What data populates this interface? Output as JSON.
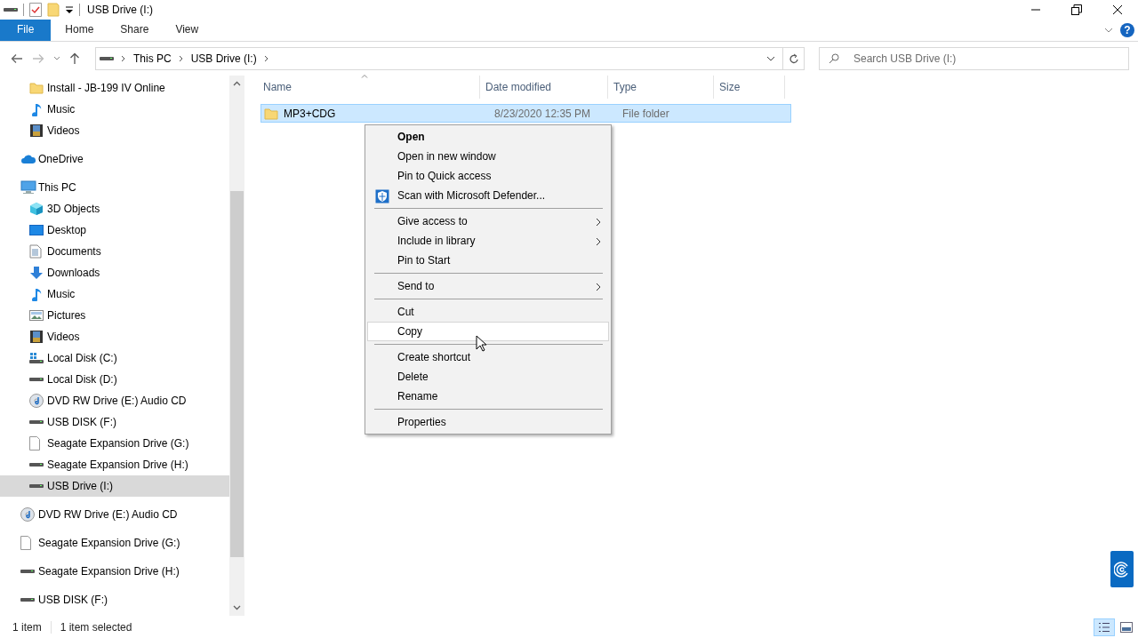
{
  "window": {
    "title": "USB Drive (I:)"
  },
  "ribbon": {
    "tabs": [
      {
        "label": "File",
        "kind": "file",
        "selected": false
      },
      {
        "label": "Home",
        "kind": "tab",
        "selected": false
      },
      {
        "label": "Share",
        "kind": "tab",
        "selected": false
      },
      {
        "label": "View",
        "kind": "tab",
        "selected": false
      }
    ],
    "help": "?"
  },
  "address": {
    "breadcrumbs": [
      "This PC",
      "USB Drive (I:)"
    ]
  },
  "search": {
    "placeholder": "Search USB Drive (I:)"
  },
  "sidebar": {
    "sections": [
      {
        "children": [
          {
            "label": "Install - JB-199 IV Online",
            "kind": "folder",
            "selected": false
          },
          {
            "label": "Music",
            "kind": "music",
            "selected": false
          },
          {
            "label": "Videos",
            "kind": "videos",
            "selected": false
          }
        ]
      },
      {
        "label": "OneDrive",
        "kind": "cloud",
        "selected": false
      },
      {
        "label": "This PC",
        "kind": "pc",
        "selected": false,
        "children": [
          {
            "label": "3D Objects",
            "kind": "cube",
            "selected": false
          },
          {
            "label": "Desktop",
            "kind": "desktop",
            "selected": false
          },
          {
            "label": "Documents",
            "kind": "documents",
            "selected": false
          },
          {
            "label": "Downloads",
            "kind": "downloads",
            "selected": false
          },
          {
            "label": "Music",
            "kind": "music",
            "selected": false
          },
          {
            "label": "Pictures",
            "kind": "pictures",
            "selected": false
          },
          {
            "label": "Videos",
            "kind": "videos",
            "selected": false
          },
          {
            "label": "Local Disk (C:)",
            "kind": "system_disk",
            "selected": false
          },
          {
            "label": "Local Disk (D:)",
            "kind": "drive",
            "selected": false
          },
          {
            "label": "DVD RW Drive (E:) Audio CD",
            "kind": "dvd",
            "selected": false
          },
          {
            "label": "USB DISK (F:)",
            "kind": "drive",
            "selected": false
          },
          {
            "label": "Seagate Expansion Drive (G:)",
            "kind": "blank",
            "selected": false
          },
          {
            "label": "Seagate Expansion Drive (H:)",
            "kind": "drive",
            "selected": false
          },
          {
            "label": "USB Drive (I:)",
            "kind": "drive",
            "selected": true
          }
        ]
      },
      {
        "label": "DVD RW Drive (E:) Audio CD",
        "kind": "dvd",
        "selected": false
      },
      {
        "label": "Seagate Expansion Drive (G:)",
        "kind": "blank",
        "selected": false
      },
      {
        "label": "Seagate Expansion Drive (H:)",
        "kind": "drive",
        "selected": false
      },
      {
        "label": "USB DISK (F:)",
        "kind": "drive",
        "selected": false
      }
    ]
  },
  "file_list": {
    "columns": [
      {
        "label": "Name",
        "sorted": true
      },
      {
        "label": "Date modified",
        "sorted": false
      },
      {
        "label": "Type",
        "sorted": false
      },
      {
        "label": "Size",
        "sorted": false
      }
    ],
    "rows": [
      {
        "name": "MP3+CDG",
        "date_modified": "8/23/2020 12:35 PM",
        "type": "File folder",
        "selected": true
      }
    ]
  },
  "context_menu": {
    "items": [
      {
        "kind": "default",
        "label": "Open",
        "submenu": false,
        "selected": false
      },
      {
        "kind": "item",
        "label": "Open in new window",
        "submenu": false,
        "selected": false
      },
      {
        "kind": "item",
        "label": "Pin to Quick access",
        "submenu": false,
        "selected": false
      },
      {
        "kind": "defender",
        "label": "Scan with Microsoft Defender...",
        "submenu": false,
        "selected": false
      },
      {
        "kind": "separator"
      },
      {
        "kind": "item",
        "label": "Give access to",
        "submenu": true,
        "selected": false
      },
      {
        "kind": "item",
        "label": "Include in library",
        "submenu": true,
        "selected": false
      },
      {
        "kind": "item",
        "label": "Pin to Start",
        "submenu": false,
        "selected": false
      },
      {
        "kind": "separator"
      },
      {
        "kind": "item",
        "label": "Send to",
        "submenu": true,
        "selected": false
      },
      {
        "kind": "separator"
      },
      {
        "kind": "item",
        "label": "Cut",
        "submenu": false,
        "selected": false
      },
      {
        "kind": "item",
        "label": "Copy",
        "submenu": false,
        "selected": true
      },
      {
        "kind": "separator"
      },
      {
        "kind": "item",
        "label": "Create shortcut",
        "submenu": false,
        "selected": false
      },
      {
        "kind": "item",
        "label": "Delete",
        "submenu": false,
        "selected": false
      },
      {
        "kind": "item",
        "label": "Rename",
        "submenu": false,
        "selected": false
      },
      {
        "kind": "separator"
      },
      {
        "kind": "item",
        "label": "Properties",
        "submenu": false,
        "selected": false
      }
    ]
  },
  "status_bar": {
    "item_count": "1 item",
    "selection": "1 item selected",
    "views": [
      {
        "kind": "details",
        "selected": true
      },
      {
        "kind": "large_icons",
        "selected": false
      }
    ]
  }
}
